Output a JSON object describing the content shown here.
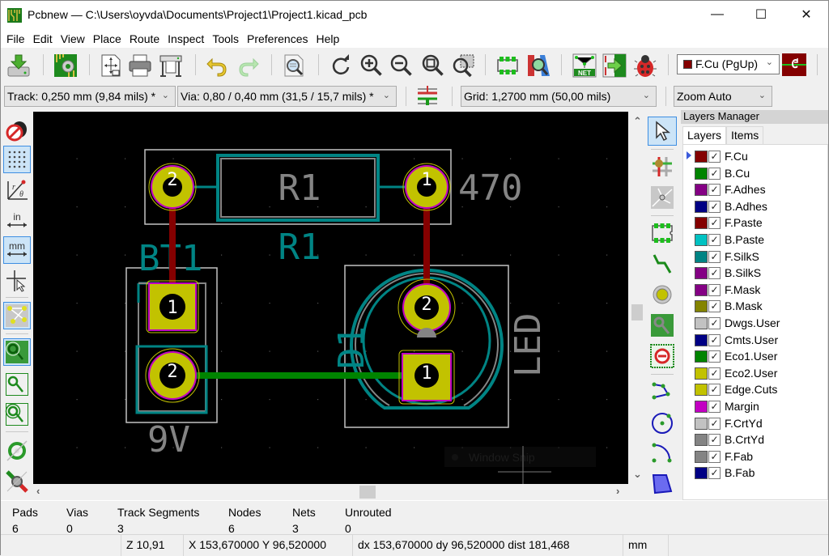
{
  "window": {
    "title": "Pcbnew — C:\\Users\\oyvda\\Documents\\Project1\\Project1.kicad_pcb",
    "minimize": "—",
    "maximize": "☐",
    "close": "✕"
  },
  "menu": [
    "File",
    "Edit",
    "View",
    "Place",
    "Route",
    "Inspect",
    "Tools",
    "Preferences",
    "Help"
  ],
  "toolbar": {
    "icons": [
      "save-icon",
      "board-setup-icon",
      "page-settings-icon",
      "print-icon",
      "plot-icon",
      "undo-icon",
      "redo-icon",
      "find-icon",
      "redraw-icon",
      "zoom-in-icon",
      "zoom-out-icon",
      "zoom-fit-icon",
      "zoom-selection-icon",
      "footprint-editor-icon",
      "footprint-browser-icon",
      "netlist-icon",
      "update-pcb-icon",
      "drc-icon",
      "layer-pair-icon"
    ],
    "active_layer": "F.Cu (PgUp)",
    "active_layer_color": "#840000"
  },
  "toolbar2": {
    "track": "Track: 0,250 mm (9,84 mils) *",
    "via": "Via: 0,80 / 0,40 mm (31,5 / 15,7 mils) *",
    "grid": "Grid: 1,2700 mm (50,00 mils)",
    "zoom": "Zoom Auto"
  },
  "left_toolbar": [
    "drc-off-icon",
    "grid-toggle-icon",
    "polar-coords-icon",
    "inch-units-icon",
    "mm-units-icon",
    "cursor-shape-icon",
    "ratsnest-icon",
    "zones-filled-icon",
    "zones-outline-icon",
    "zones-sketch-icon",
    "pads-sketch-icon",
    "tracks-sketch-icon"
  ],
  "right_toolbar": [
    "select-icon",
    "highlight-net-icon",
    "local-ratsnest-icon",
    "add-footprint-icon",
    "route-track-icon",
    "add-via-icon",
    "add-zone-icon",
    "keepout-icon",
    "add-line-icon",
    "add-circle-icon",
    "add-arc-icon",
    "add-polygon-icon"
  ],
  "canvas": {
    "labels": {
      "r1_value": "470",
      "r1_ref_fab": "R1",
      "r1_ref_silk": "R1",
      "bt1_ref": "BT1",
      "bt1_value": "9V",
      "d1_ref": "D1",
      "d1_value": "LED"
    },
    "pads": {
      "r1_p2": "2",
      "r1_p1": "1",
      "bt1_p1": "1",
      "bt1_p2": "2",
      "d1_p2": "2",
      "d1_p1": "1"
    },
    "tooltip": "Window Snip"
  },
  "layers_manager": {
    "title": "Layers Manager",
    "tabs": [
      "Layers",
      "Items"
    ],
    "layers": [
      {
        "name": "F.Cu",
        "color": "#840000",
        "checked": true,
        "active": true
      },
      {
        "name": "B.Cu",
        "color": "#008400",
        "checked": true
      },
      {
        "name": "F.Adhes",
        "color": "#840084",
        "checked": true
      },
      {
        "name": "B.Adhes",
        "color": "#000084",
        "checked": true
      },
      {
        "name": "F.Paste",
        "color": "#840000",
        "checked": true
      },
      {
        "name": "B.Paste",
        "color": "#00c2c2",
        "checked": true
      },
      {
        "name": "F.SilkS",
        "color": "#008484",
        "checked": true
      },
      {
        "name": "B.SilkS",
        "color": "#840084",
        "checked": true
      },
      {
        "name": "F.Mask",
        "color": "#840084",
        "checked": true
      },
      {
        "name": "B.Mask",
        "color": "#848400",
        "checked": true
      },
      {
        "name": "Dwgs.User",
        "color": "#c2c2c2",
        "checked": true
      },
      {
        "name": "Cmts.User",
        "color": "#000084",
        "checked": true
      },
      {
        "name": "Eco1.User",
        "color": "#008400",
        "checked": true
      },
      {
        "name": "Eco2.User",
        "color": "#c2c200",
        "checked": true
      },
      {
        "name": "Edge.Cuts",
        "color": "#c2c200",
        "checked": true
      },
      {
        "name": "Margin",
        "color": "#c200c2",
        "checked": true
      },
      {
        "name": "F.CrtYd",
        "color": "#c2c2c2",
        "checked": true
      },
      {
        "name": "B.CrtYd",
        "color": "#848484",
        "checked": true
      },
      {
        "name": "F.Fab",
        "color": "#848484",
        "checked": true
      },
      {
        "name": "B.Fab",
        "color": "#000084",
        "checked": true
      }
    ]
  },
  "stats": [
    {
      "label": "Pads",
      "value": "6"
    },
    {
      "label": "Vias",
      "value": "0"
    },
    {
      "label": "Track Segments",
      "value": "3"
    },
    {
      "label": "Nodes",
      "value": "6"
    },
    {
      "label": "Nets",
      "value": "3"
    },
    {
      "label": "Unrouted",
      "value": "0"
    }
  ],
  "statusbar": {
    "zoom": "Z 10,91",
    "xy": "X 153,670000  Y 96,520000",
    "delta": "dx 153,670000  dy 96,520000  dist 181,468",
    "units": "mm"
  }
}
